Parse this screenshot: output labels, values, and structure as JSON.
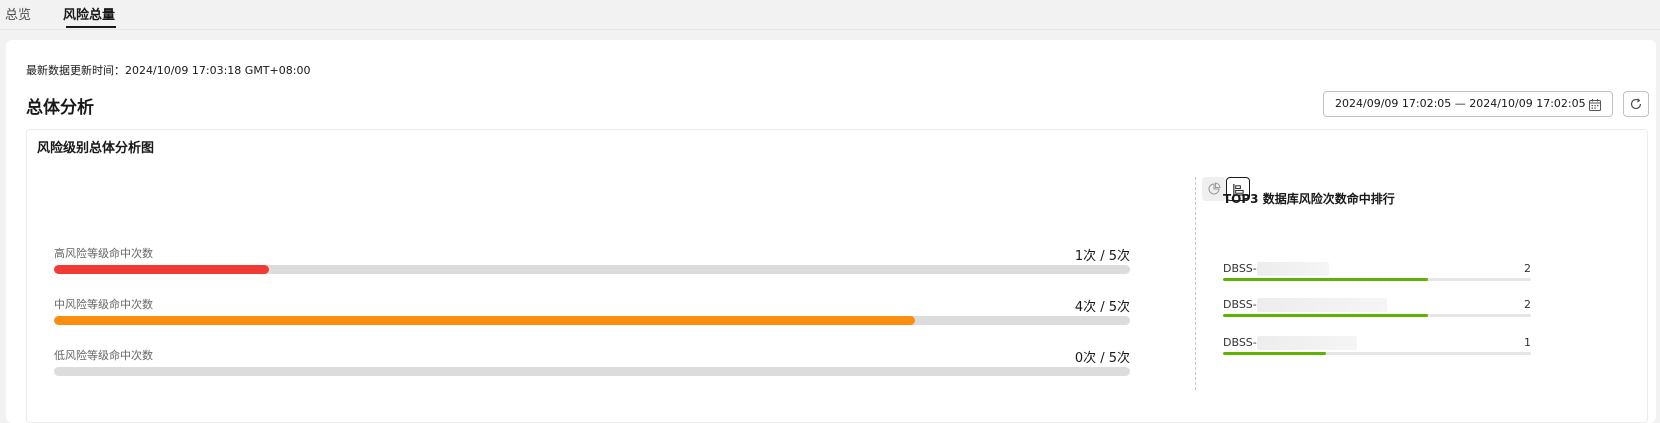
{
  "tabs": [
    {
      "label": "总览",
      "active": false
    },
    {
      "label": "风险总量",
      "active": true
    }
  ],
  "header": {
    "update_time": "最新数据更新时间：2024/10/09 17:03:18 GMT+08:00",
    "section_title": "总体分析",
    "date_range": "2024/09/09 17:02:05 — 2024/10/09 17:02:05",
    "icons": {
      "calendar": "calendar-icon",
      "refresh": "refresh-icon"
    }
  },
  "panel": {
    "title": "风险级别总体分析图",
    "view_toggle": {
      "options": [
        "pie-chart-icon",
        "bar-chart-icon"
      ],
      "selected": "bar-chart-icon"
    }
  },
  "risk_levels": [
    {
      "label": "高风险等级命中次数",
      "count_text": "1次 / 5次",
      "hits": 1,
      "total": 5,
      "color": "#f23a35"
    },
    {
      "label": "中风险等级命中次数",
      "count_text": "4次 / 5次",
      "hits": 4,
      "total": 5,
      "color": "#f98e0f"
    },
    {
      "label": "低风险等级命中次数",
      "count_text": "0次 / 5次",
      "hits": 0,
      "total": 5,
      "color": "#5cb300"
    }
  ],
  "top3": {
    "title": "TOP3 数据库风险次数命中排行",
    "max": 3,
    "items": [
      {
        "name": "DBSS-",
        "value": "2",
        "hits": 2,
        "color": "#5cb300"
      },
      {
        "name": "DBSS-",
        "value": "2",
        "hits": 2,
        "color": "#5cb300"
      },
      {
        "name": "DBSS-",
        "value": "1",
        "hits": 1,
        "color": "#5cb300"
      }
    ]
  }
}
